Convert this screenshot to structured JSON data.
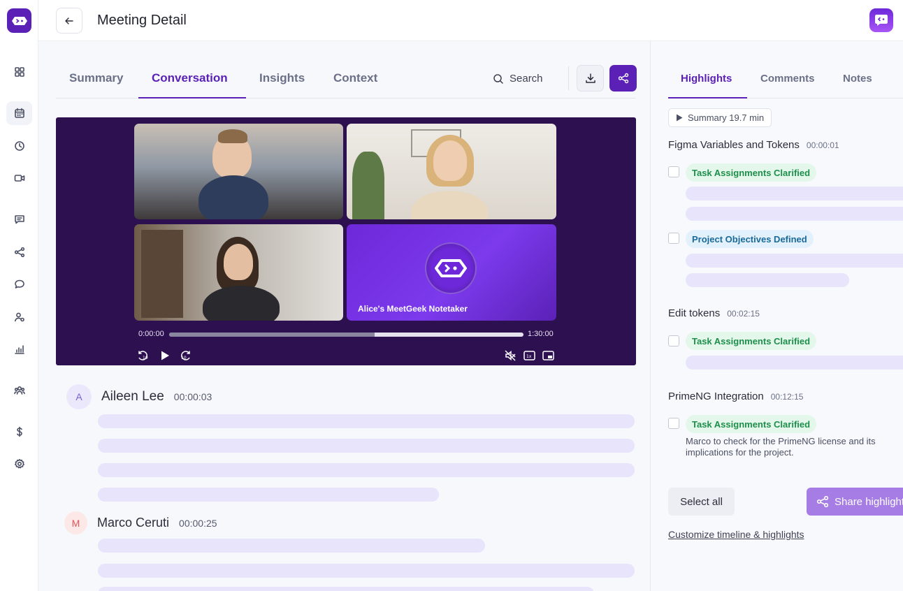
{
  "header": {
    "title": "Meeting Detail"
  },
  "sidebar": {
    "items": [
      {
        "name": "dashboard-icon"
      },
      {
        "name": "calendar-icon"
      },
      {
        "name": "clock-icon"
      },
      {
        "name": "video-icon"
      },
      {
        "name": "message-square-icon"
      },
      {
        "name": "workflow-icon"
      },
      {
        "name": "chat-bubble-icon"
      },
      {
        "name": "users-icon"
      },
      {
        "name": "analytics-icon"
      },
      {
        "name": "team-icon"
      },
      {
        "name": "dollar-icon"
      },
      {
        "name": "settings-icon"
      }
    ],
    "active_index": 1
  },
  "main": {
    "tabs": [
      {
        "label": "Summary"
      },
      {
        "label": "Conversation"
      },
      {
        "label": "Insights"
      },
      {
        "label": "Context"
      }
    ],
    "active_tab": "Conversation",
    "search_label": "Search",
    "video": {
      "notetaker_label": "Alice's MeetGeek Notetaker",
      "current_time": "0:00:00",
      "total_time": "1:30:00",
      "progress": 0.58
    },
    "transcript": [
      {
        "initial": "A",
        "name": "Aileen Lee",
        "time": "00:00:03"
      },
      {
        "initial": "M",
        "name": "Marco Ceruti",
        "time": "00:00:25"
      }
    ]
  },
  "highlights": {
    "tabs": [
      {
        "label": "Highlights"
      },
      {
        "label": "Comments"
      },
      {
        "label": "Notes"
      }
    ],
    "active_tab": "Highlights",
    "summary_chip": "Summary 19.7 min",
    "sections": [
      {
        "title": "Figma Variables and Tokens",
        "time": "00:00:01"
      },
      {
        "title": "Edit tokens",
        "time": "00:02:15"
      },
      {
        "title": "PrimeNG Integration",
        "time": "00:12:15"
      }
    ],
    "tags": [
      {
        "label": "Task Assignments Clarified"
      },
      {
        "label": "Project Objectives Defined"
      },
      {
        "label": "Task Assignments Clarified"
      },
      {
        "label": "Task Assignments Clarified"
      }
    ],
    "note": "Marco to check for the PrimeNG license and its implications for the project.",
    "select_all_label": "Select all",
    "share_label": "Share highlights",
    "customize_label": "Customize timeline & highlights"
  },
  "colors": {
    "accent": "#5b21b6",
    "skeleton": "#e7e4fb",
    "tag_green_bg": "#e3f8ea",
    "tag_green_text": "#1e8e4b",
    "tag_blue_bg": "#e2f1fb",
    "tag_blue_text": "#1a6a9a"
  }
}
